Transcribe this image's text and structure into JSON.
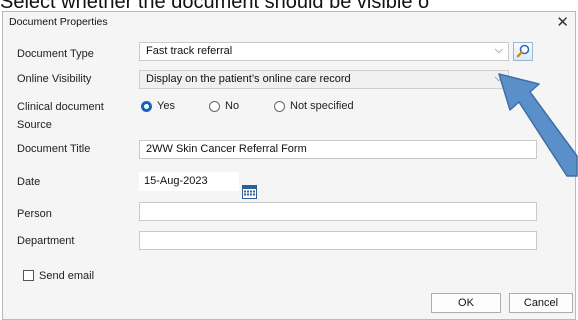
{
  "caption": "Select whether the document should be visible o",
  "dialog": {
    "title": "Document Properties"
  },
  "fields": {
    "document_type": {
      "label": "Document Type",
      "value": "Fast track referral"
    },
    "online_visibility": {
      "label": "Online Visibility",
      "value": "Display on the patient’s online care record"
    },
    "clinical_source": {
      "label_line1": "Clinical document",
      "label_line2": "Source",
      "options": [
        "Yes",
        "No",
        "Not specified"
      ],
      "selected": "Yes"
    },
    "document_title": {
      "label": "Document Title",
      "value": "2WW Skin Cancer Referral Form"
    },
    "date": {
      "label": "Date",
      "value": "15-Aug-2023"
    },
    "person": {
      "label": "Person",
      "value": ""
    },
    "department": {
      "label": "Department",
      "value": ""
    }
  },
  "send_email": {
    "label": "Send email",
    "checked": false
  },
  "buttons": {
    "ok": "OK",
    "cancel": "Cancel"
  },
  "colors": {
    "accent_arrow": "#5b8fc9",
    "radio_selected": "#1565c0"
  }
}
